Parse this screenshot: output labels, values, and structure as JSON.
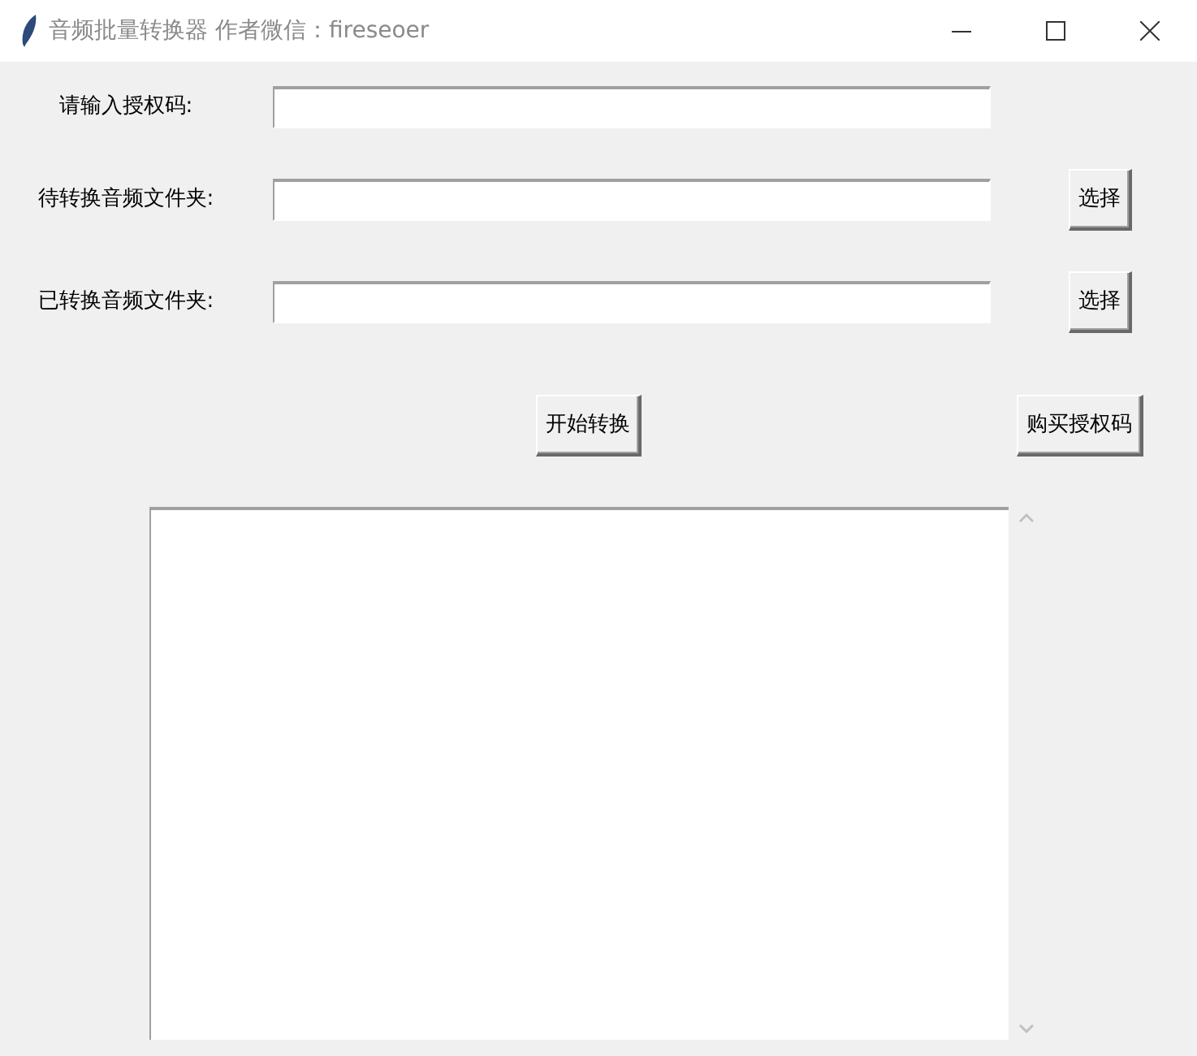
{
  "window": {
    "title": "音频批量转换器 作者微信：fireseoer"
  },
  "fields": [
    {
      "label": "请输入授权码:"
    },
    {
      "label": "待转换音频文件夹:",
      "button": "选择"
    },
    {
      "label": "已转换音频文件夹:",
      "button": "选择"
    }
  ],
  "actions": [
    {
      "label": "开始转换"
    },
    {
      "label": "购买授权码"
    }
  ],
  "log": {
    "kind": "text-area"
  }
}
